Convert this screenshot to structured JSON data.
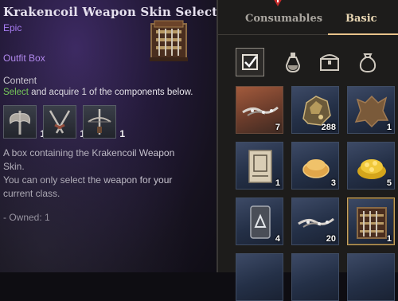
{
  "tooltip": {
    "title": "Krakencoil Weapon Skin Selection B",
    "rarity": "Epic",
    "type": "Outfit Box",
    "content_label": "Content",
    "select_highlight": "Select",
    "select_rest": " and acquire 1 of the components below.",
    "components": [
      {
        "icon": "axe-icon",
        "count": "1"
      },
      {
        "icon": "crossed-swords-icon",
        "count": "1"
      },
      {
        "icon": "crossbow-icon",
        "count": "1"
      }
    ],
    "description": [
      "A box containing the Krakencoil Weapon",
      "Skin.",
      "You can only select the weapon for your",
      "current class."
    ],
    "owned": "- Owned: 1"
  },
  "inventory": {
    "tabs": [
      "Consumables",
      "Basic"
    ],
    "active_tab": "Basic",
    "filters": [
      "checkbox-icon",
      "potion-icon",
      "chest-icon",
      "pouch-icon"
    ],
    "slots": [
      {
        "icon": "tentacle-skin-icon",
        "count": "7",
        "frame": "orange"
      },
      {
        "icon": "ore-icon",
        "count": "288",
        "frame": "blue"
      },
      {
        "icon": "hide-icon",
        "count": "1",
        "frame": "blue"
      },
      {
        "icon": "scroll-icon",
        "count": "1",
        "frame": "blue"
      },
      {
        "icon": "bread-icon",
        "count": "3",
        "frame": "blue"
      },
      {
        "icon": "gold-coins-icon",
        "count": "5",
        "frame": "blue"
      },
      {
        "icon": "rune-tablet-icon",
        "count": "4",
        "frame": "blue"
      },
      {
        "icon": "tentacle-skin-icon",
        "count": "20",
        "frame": "blue"
      },
      {
        "icon": "weapon-rack-icon",
        "count": "1",
        "frame": "selected"
      }
    ]
  },
  "colors": {
    "epic": "#a77cf2",
    "select": "#7ad35a",
    "tab_active": "#e9d7b4"
  }
}
